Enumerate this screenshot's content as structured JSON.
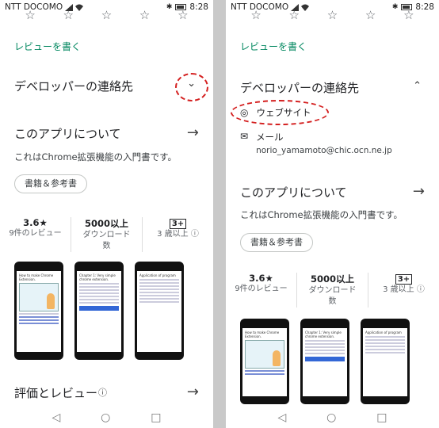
{
  "status_bar": {
    "carrier": "NTT DOCOMO",
    "time": "8:28"
  },
  "stars": [
    "☆",
    "☆",
    "☆",
    "☆",
    "☆"
  ],
  "left": {
    "review_link": "レビューを書く",
    "developer_contact": "デベロッパーの連絡先",
    "about_title": "このアプリについて",
    "description": "これはChrome拡張機能の入門書です。",
    "chip": "書籍＆参考書",
    "stats": [
      {
        "value": "3.6★",
        "label": "9件のレビュー"
      },
      {
        "value": "5000以上",
        "label": "ダウンロード\n数"
      },
      {
        "value": "3+",
        "label": "3 歳以上 ⓘ"
      }
    ],
    "ratings_title": "評価とレビュー",
    "ratings_info": "ⓘ"
  },
  "right": {
    "review_link": "レビューを書く",
    "developer_contact": "デベロッパーの連絡先",
    "website_label": "ウェブサイト",
    "mail_label": "メール",
    "mail_address": "norio_yamamoto@chic.ocn.ne.jp",
    "about_title": "このアプリについて",
    "description": "これはChrome拡張機能の入門書です。",
    "chip": "書籍＆参考書",
    "stats": [
      {
        "value": "3.6★",
        "label": "9件のレビュー"
      },
      {
        "value": "5000以上",
        "label": "ダウンロード\n数"
      },
      {
        "value": "3+",
        "label": "3 歳以上 ⓘ"
      }
    ]
  },
  "screenshots": {
    "shot1_title": "How to make Chrome Extension.",
    "shot2_title": "Chapter 1: Very simple chrome extension.",
    "shot3_title": "Application of program"
  },
  "icons": {
    "arrow": "→",
    "chevron_down": "⌄",
    "chevron_up": "⌃",
    "globe": "🌐",
    "mail": "✉",
    "nav_back": "◁",
    "nav_home": "○",
    "nav_recent": "□"
  },
  "colors": {
    "accent": "#01875f",
    "highlight": "#d41f1f"
  }
}
